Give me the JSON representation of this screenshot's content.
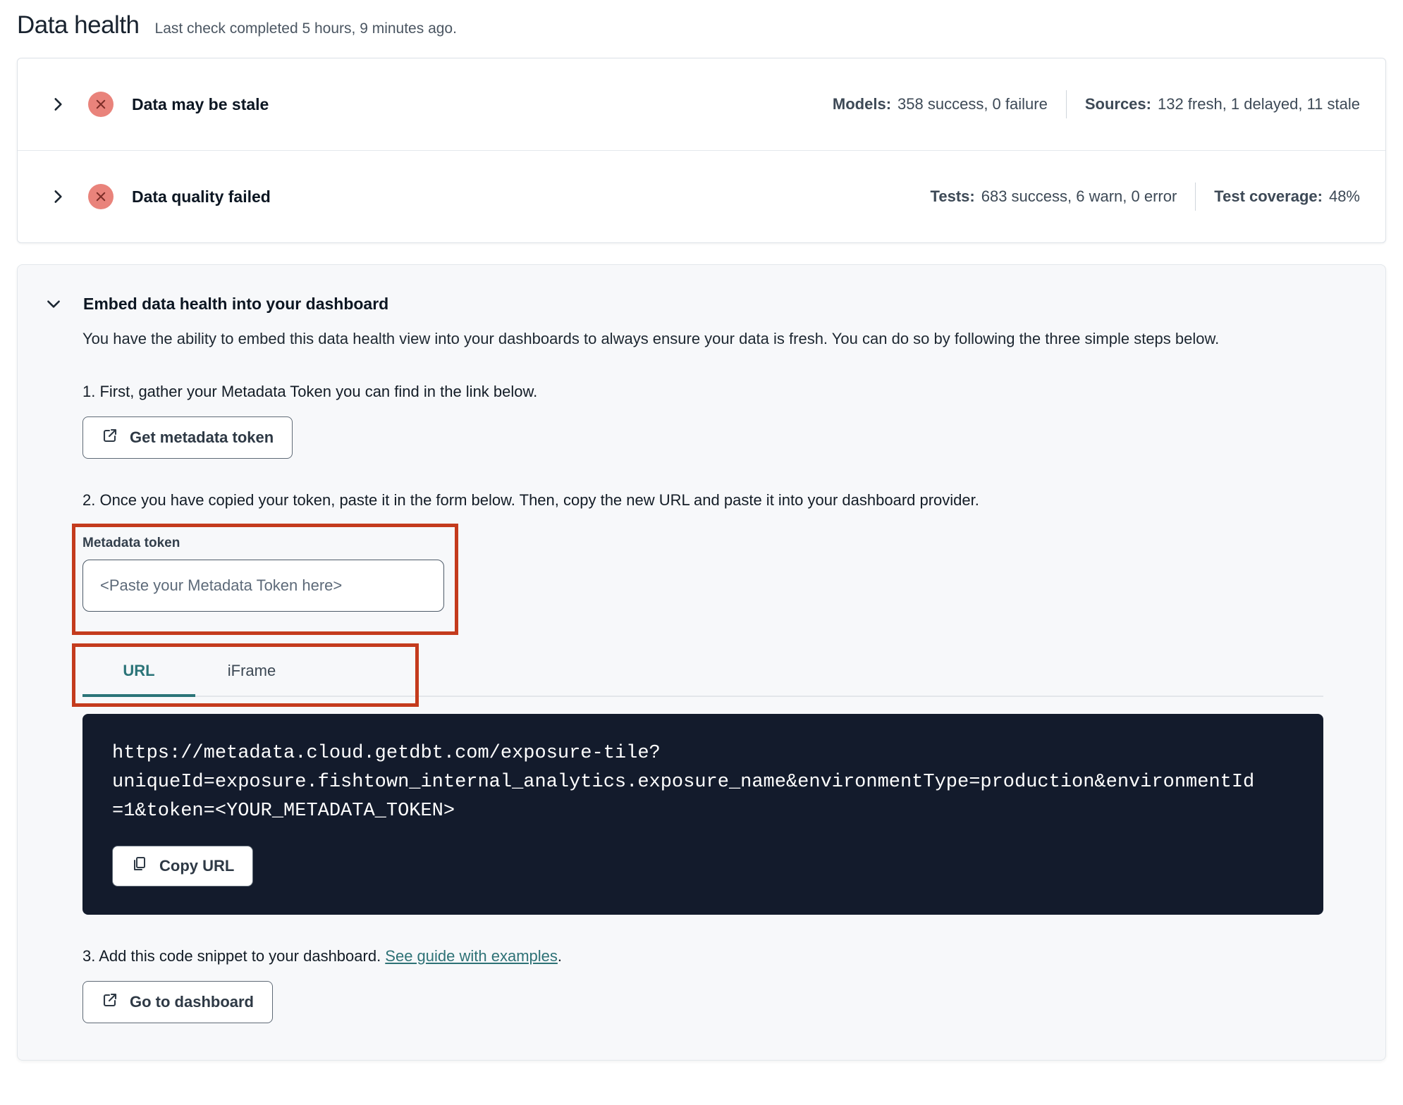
{
  "page": {
    "title": "Data health",
    "subtitle": "Last check completed 5 hours, 9 minutes ago."
  },
  "status_rows": [
    {
      "title": "Data may be stale",
      "status_icon": "error-x-circle",
      "stats": [
        {
          "label": "Models:",
          "value": "358 success, 0 failure"
        },
        {
          "label": "Sources:",
          "value": "132 fresh, 1 delayed, 11 stale"
        }
      ]
    },
    {
      "title": "Data quality failed",
      "status_icon": "error-x-circle",
      "stats": [
        {
          "label": "Tests:",
          "value": "683 success, 6 warn, 0 error"
        },
        {
          "label": "Test coverage:",
          "value": "48%"
        }
      ]
    }
  ],
  "embed": {
    "title": "Embed data health into your dashboard",
    "description": "You have the ability to embed this data health view into your dashboards to always ensure your data is fresh. You can do so by following the three simple steps below.",
    "step1": "1. First, gather your Metadata Token you can find in the link below.",
    "get_token_button": "Get metadata token",
    "step2": "2. Once you have copied your token, paste it in the form below. Then, copy the new URL and paste it into your dashboard provider.",
    "token_label": "Metadata token",
    "token_placeholder": "<Paste your Metadata Token here>",
    "token_value": "",
    "tabs": [
      {
        "label": "URL",
        "active": true
      },
      {
        "label": "iFrame",
        "active": false
      }
    ],
    "url": "https://metadata.cloud.getdbt.com/exposure-tile?uniqueId=exposure.fishtown_internal_analytics.exposure_name&environmentType=production&environmentId=1&token=<YOUR_METADATA_TOKEN>",
    "url_lines": [
      "https://metadata.cloud.getdbt.com/exposure-tile?",
      "uniqueId=exposure.fishtown_internal_analytics.exposure_name&environmentType=production&environmentId",
      "=1&token=<YOUR_METADATA_TOKEN>"
    ],
    "copy_button": "Copy URL",
    "step3_prefix": "3. Add this code snippet to your dashboard. ",
    "step3_link": "See guide with examples",
    "step3_suffix": ".",
    "dashboard_button": "Go to dashboard"
  },
  "icons": {
    "chevron_right": "collapsed expander",
    "chevron_down": "expanded expander",
    "error_badge": "red circle with x",
    "external_link": "open in new window",
    "copy": "copy to clipboard"
  },
  "colors": {
    "accent_teal": "#2b7478",
    "annotation_red": "#c43b1d",
    "error_badge_bg": "#e9837b",
    "error_badge_x": "#7c2d27",
    "code_block_bg": "#131b2c",
    "panel_bg": "#f7f8fa",
    "text_dark": "#0c1622",
    "text_stats": "#3d4956"
  }
}
